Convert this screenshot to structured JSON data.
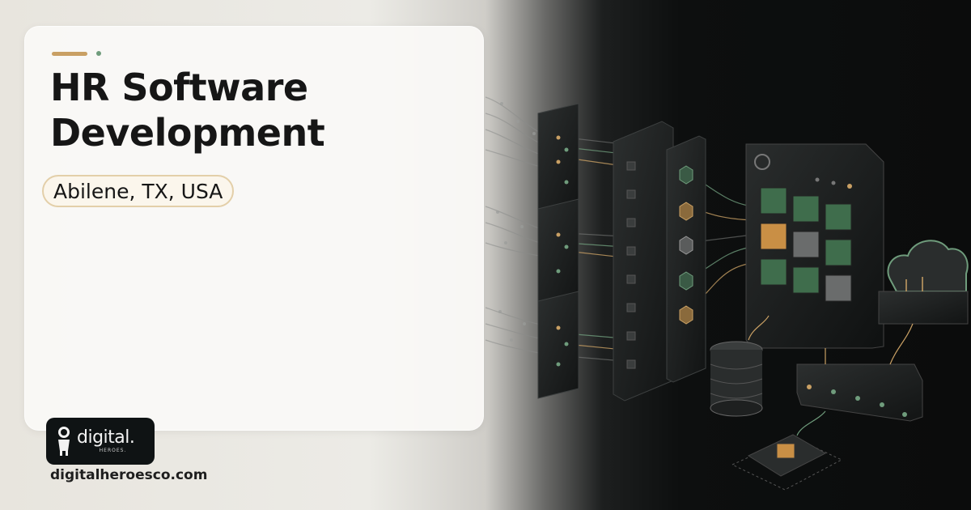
{
  "hero": {
    "title": "HR Software Development",
    "location": "Abilene, TX, USA"
  },
  "brand": {
    "logo_text": "digital.",
    "logo_subtext": "HEROES.",
    "website": "digitalheroesco.com",
    "logo_icon": "mascot-icon"
  },
  "illustration": {
    "subject": "isometric server-network-cloud-icon",
    "colors": {
      "accent_gold": "#c9a064",
      "accent_green": "#6f9c7c",
      "panel_dark": "#1a1c1c"
    }
  }
}
